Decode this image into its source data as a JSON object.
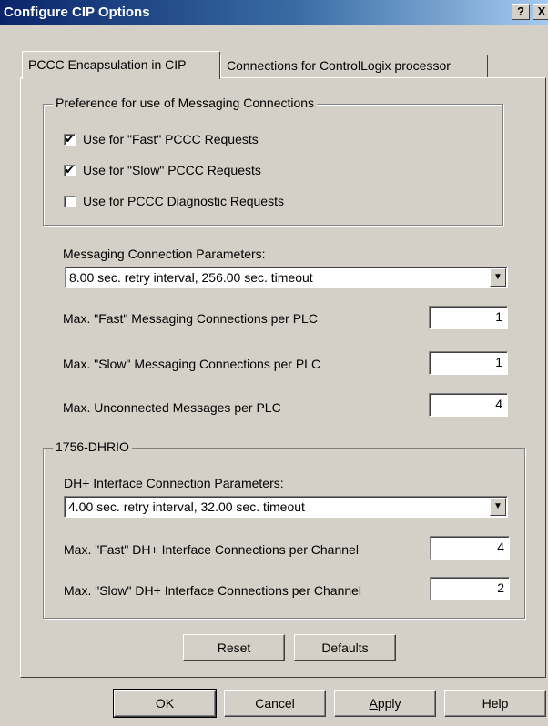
{
  "window": {
    "title": "Configure CIP Options",
    "help_label": "?",
    "close_label": "X"
  },
  "tabs": [
    {
      "label": "PCCC Encapsulation in CIP",
      "active": true
    },
    {
      "label": "Connections for ControlLogix processor",
      "active": false
    }
  ],
  "preference_group": {
    "legend": "Preference for use of Messaging Connections",
    "checkboxes": [
      {
        "label": "Use for \"Fast\" PCCC Requests",
        "checked": true
      },
      {
        "label": "Use for \"Slow\" PCCC Requests",
        "checked": true
      },
      {
        "label": "Use for PCCC Diagnostic Requests",
        "checked": false
      }
    ]
  },
  "messaging": {
    "params_label": "Messaging Connection Parameters:",
    "params_value": "8.00 sec. retry interval, 256.00 sec. timeout",
    "fields": [
      {
        "label": "Max. \"Fast\" Messaging Connections per PLC",
        "value": "1"
      },
      {
        "label": "Max. \"Slow\" Messaging Connections per PLC",
        "value": "1"
      },
      {
        "label": "Max. Unconnected Messages per PLC",
        "value": "4"
      }
    ]
  },
  "dhrio_group": {
    "legend": "1756-DHRIO",
    "params_label": "DH+ Interface Connection Parameters:",
    "params_value": "4.00 sec. retry interval, 32.00 sec. timeout",
    "fields": [
      {
        "label": "Max. \"Fast\" DH+ Interface Connections per Channel",
        "value": "4"
      },
      {
        "label": "Max. \"Slow\" DH+ Interface Connections per Channel",
        "value": "2"
      }
    ]
  },
  "panel_buttons": {
    "reset": "Reset",
    "defaults": "Defaults"
  },
  "dialog_buttons": {
    "ok": "OK",
    "cancel": "Cancel",
    "apply_prefix": "A",
    "apply_rest": "pply",
    "help": "Help"
  },
  "icons": {
    "checkmark": "✔",
    "dropdown": "▼"
  }
}
